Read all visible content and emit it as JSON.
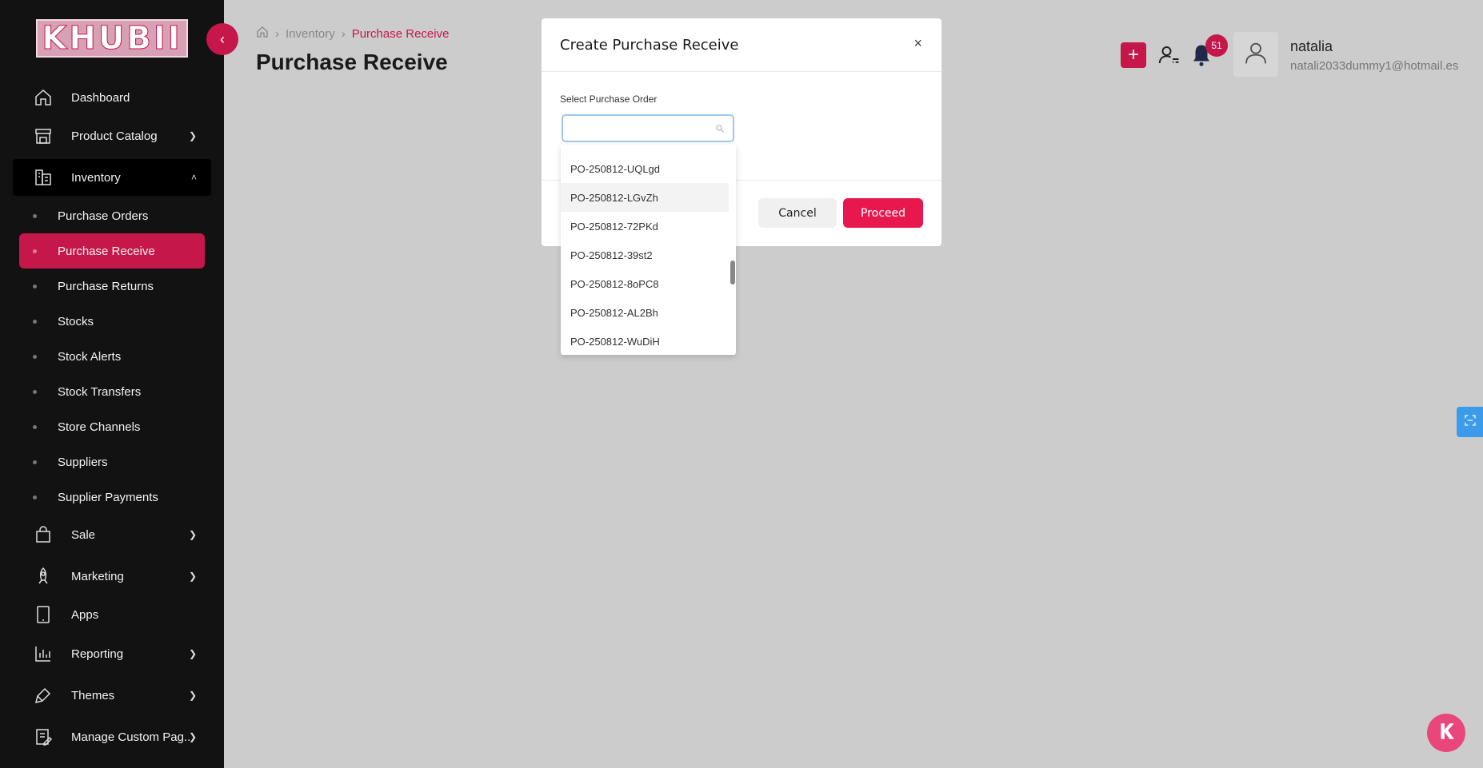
{
  "sidebar": {
    "logo_text": "KHUBII",
    "items": [
      {
        "label": "Dashboard"
      },
      {
        "label": "Product Catalog"
      },
      {
        "label": "Inventory"
      },
      {
        "label": "Sale"
      },
      {
        "label": "Marketing"
      },
      {
        "label": "Apps"
      },
      {
        "label": "Reporting"
      },
      {
        "label": "Themes"
      },
      {
        "label": "Manage Custom Pag.."
      }
    ],
    "inventory_sub": [
      {
        "label": "Purchase Orders"
      },
      {
        "label": "Purchase Receive"
      },
      {
        "label": "Purchase Returns"
      },
      {
        "label": "Stocks"
      },
      {
        "label": "Stock Alerts"
      },
      {
        "label": "Stock Transfers"
      },
      {
        "label": "Store Channels"
      },
      {
        "label": "Suppliers"
      },
      {
        "label": "Supplier Payments"
      }
    ]
  },
  "breadcrumb": {
    "parent": "Inventory",
    "current": "Purchase Receive"
  },
  "page": {
    "title": "Purchase Receive"
  },
  "header": {
    "notification_count": "51",
    "user_name": "natalia",
    "user_email": "natali2033dummy1@hotmail.es"
  },
  "modal": {
    "title": "Create Purchase Receive",
    "close": "×",
    "field_label": "Select Purchase Order",
    "search_value": "",
    "cancel_label": "Cancel",
    "proceed_label": "Proceed",
    "options": [
      "PO-250812-UQLgd",
      "PO-250812-LGvZh",
      "PO-250812-72PKd",
      "PO-250812-39st2",
      "PO-250812-8oPC8",
      "PO-250812-AL2Bh",
      "PO-250812-WuDiH"
    ]
  },
  "colors": {
    "accent": "#c5174a",
    "proceed": "#e8184f",
    "sidebar_bg": "#121212",
    "overlay": "#cccccc"
  }
}
